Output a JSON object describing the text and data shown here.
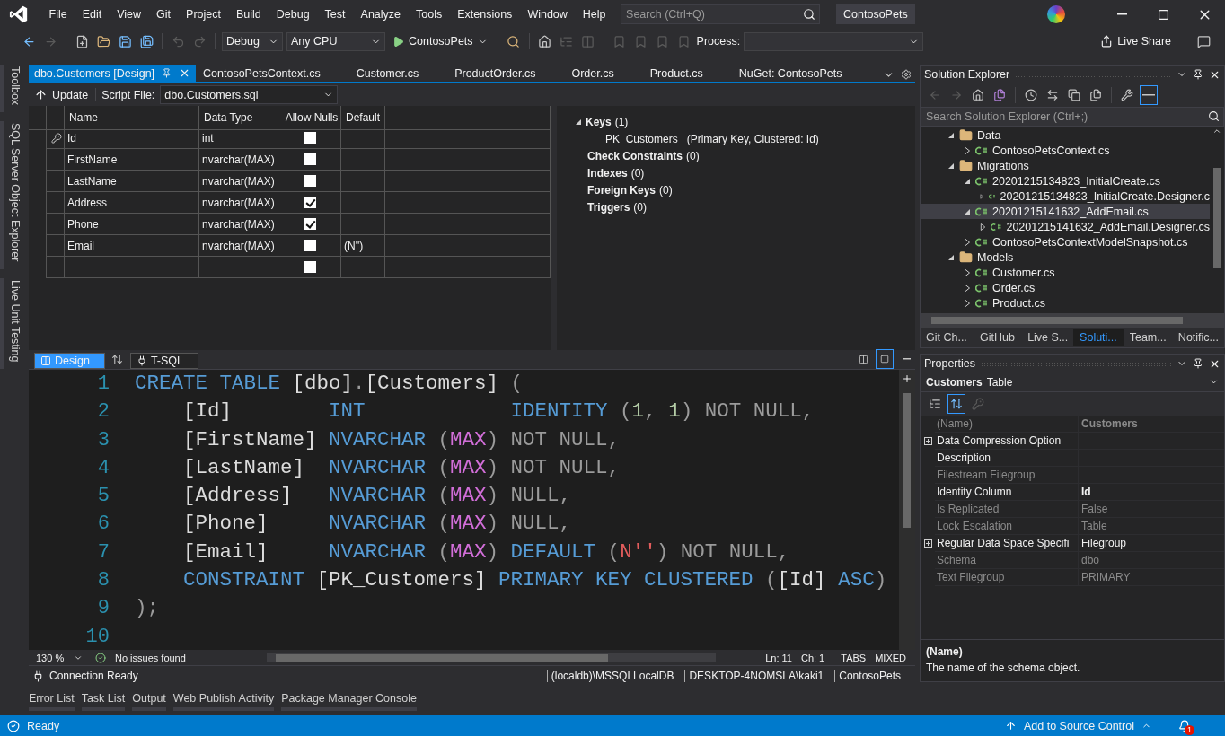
{
  "menu": {
    "items": [
      "File",
      "Edit",
      "View",
      "Git",
      "Project",
      "Build",
      "Debug",
      "Test",
      "Analyze",
      "Tools",
      "Extensions",
      "Window",
      "Help"
    ],
    "search": {
      "placeholder": "Search (Ctrl+Q)"
    },
    "solution_name": "ContosoPets"
  },
  "toolbar": {
    "configuration": "Debug",
    "platform": "Any CPU",
    "start_target": "ContosoPets",
    "process_label": "Process:",
    "live_share": "Live Share"
  },
  "side_tabs": [
    "Toolbox",
    "SQL Server Object Explorer",
    "Live Unit Testing"
  ],
  "document_tabs": [
    {
      "label": "dbo.Customers [Design]",
      "selected": true
    },
    {
      "label": "ContosoPetsContext.cs",
      "selected": false
    },
    {
      "label": "Customer.cs",
      "selected": false
    },
    {
      "label": "ProductOrder.cs",
      "selected": false
    },
    {
      "label": "Order.cs",
      "selected": false
    },
    {
      "label": "Product.cs",
      "selected": false
    },
    {
      "label": "NuGet: ContosoPets",
      "selected": false
    }
  ],
  "designer": {
    "update": "Update",
    "script_file_label": "Script File:",
    "script_file": "dbo.Customers.sql",
    "column_headers": [
      "Name",
      "Data Type",
      "Allow Nulls",
      "Default"
    ],
    "rows": [
      {
        "name": "Id",
        "data_type": "int",
        "allow_nulls": false,
        "primary_key": true
      },
      {
        "name": "FirstName",
        "data_type": "nvarchar(MAX)",
        "allow_nulls": false,
        "primary_key": false
      },
      {
        "name": "LastName",
        "data_type": "nvarchar(MAX)",
        "allow_nulls": false,
        "primary_key": false
      },
      {
        "name": "Address",
        "data_type": "nvarchar(MAX)",
        "allow_nulls": true,
        "primary_key": false
      },
      {
        "name": "Phone",
        "data_type": "nvarchar(MAX)",
        "allow_nulls": true,
        "primary_key": false
      },
      {
        "name": "Email",
        "data_type": "nvarchar(MAX)",
        "allow_nulls": false,
        "primary_key": false,
        "default": "(N'')"
      },
      {
        "allow_nulls": false,
        "primary_key": false
      }
    ],
    "sections": [
      {
        "title": "Keys",
        "count": "(1)",
        "expanded": true,
        "children": [
          {
            "name": "PK_Customers",
            "detail": "(Primary Key, Clustered: Id)"
          }
        ]
      },
      {
        "title": "Check Constraints",
        "count": "(0)"
      },
      {
        "title": "Indexes",
        "count": "(0)"
      },
      {
        "title": "Foreign Keys",
        "count": "(0)"
      },
      {
        "title": "Triggers",
        "count": "(0)"
      }
    ]
  },
  "view_tabs": [
    {
      "label": "Design",
      "selected": true
    },
    {
      "label": "T-SQL",
      "selected": false
    }
  ],
  "editor": {
    "lines": [
      {
        "number": "1",
        "tokens": [
          {
            "kind": "keyword",
            "text": "CREATE TABLE"
          },
          {
            "kind": "ident",
            "text": " [dbo]"
          },
          {
            "kind": "punct",
            "text": "."
          },
          {
            "kind": "ident",
            "text": "[Customers] "
          },
          {
            "kind": "punct",
            "text": "("
          }
        ]
      },
      {
        "number": "2",
        "tokens": [
          {
            "kind": "ident",
            "text": "    [Id]        "
          },
          {
            "kind": "keyword",
            "text": "INT            "
          },
          {
            "kind": "keyword",
            "text": "IDENTITY"
          },
          {
            "kind": "punct",
            "text": " ("
          },
          {
            "kind": "number",
            "text": "1"
          },
          {
            "kind": "punct",
            "text": ", "
          },
          {
            "kind": "number",
            "text": "1"
          },
          {
            "kind": "punct",
            "text": ") NOT NULL,"
          }
        ]
      },
      {
        "number": "3",
        "tokens": [
          {
            "kind": "ident",
            "text": "    [FirstName] "
          },
          {
            "kind": "keyword",
            "text": "NVARCHAR"
          },
          {
            "kind": "punct",
            "text": " ("
          },
          {
            "kind": "function",
            "text": "MAX"
          },
          {
            "kind": "punct",
            "text": ") NOT NULL,"
          }
        ]
      },
      {
        "number": "4",
        "tokens": [
          {
            "kind": "ident",
            "text": "    [LastName]  "
          },
          {
            "kind": "keyword",
            "text": "NVARCHAR"
          },
          {
            "kind": "punct",
            "text": " ("
          },
          {
            "kind": "function",
            "text": "MAX"
          },
          {
            "kind": "punct",
            "text": ") NOT NULL,"
          }
        ]
      },
      {
        "number": "5",
        "tokens": [
          {
            "kind": "ident",
            "text": "    [Address]   "
          },
          {
            "kind": "keyword",
            "text": "NVARCHAR"
          },
          {
            "kind": "punct",
            "text": " ("
          },
          {
            "kind": "function",
            "text": "MAX"
          },
          {
            "kind": "punct",
            "text": ") NULL,"
          }
        ]
      },
      {
        "number": "6",
        "tokens": [
          {
            "kind": "ident",
            "text": "    [Phone]     "
          },
          {
            "kind": "keyword",
            "text": "NVARCHAR"
          },
          {
            "kind": "punct",
            "text": " ("
          },
          {
            "kind": "function",
            "text": "MAX"
          },
          {
            "kind": "punct",
            "text": ") NULL,"
          }
        ]
      },
      {
        "number": "7",
        "tokens": [
          {
            "kind": "ident",
            "text": "    [Email]     "
          },
          {
            "kind": "keyword",
            "text": "NVARCHAR"
          },
          {
            "kind": "punct",
            "text": " ("
          },
          {
            "kind": "function",
            "text": "MAX"
          },
          {
            "kind": "punct",
            "text": ") "
          },
          {
            "kind": "keyword",
            "text": "DEFAULT"
          },
          {
            "kind": "punct",
            "text": " ("
          },
          {
            "kind": "string",
            "text": "N''"
          },
          {
            "kind": "punct",
            "text": ") NOT NULL,"
          }
        ]
      },
      {
        "number": "8",
        "tokens": [
          {
            "kind": "keyword",
            "text": "    CONSTRAINT"
          },
          {
            "kind": "ident",
            "text": " [PK_Customers] "
          },
          {
            "kind": "keyword",
            "text": "PRIMARY KEY CLUSTERED"
          },
          {
            "kind": "punct",
            "text": " ("
          },
          {
            "kind": "ident",
            "text": "[Id] "
          },
          {
            "kind": "keyword",
            "text": "ASC"
          },
          {
            "kind": "punct",
            "text": ")"
          }
        ]
      },
      {
        "number": "9",
        "tokens": [
          {
            "kind": "punct",
            "text": ");"
          }
        ]
      },
      {
        "number": "10"
      }
    ]
  },
  "editor_status": {
    "zoom": "130 %",
    "issues": "No issues found",
    "line": "Ln: 11",
    "column": "Ch: 1",
    "indent": "TABS",
    "line_endings": "MIXED"
  },
  "connection": {
    "state": "Connection Ready",
    "server": "(localdb)\\MSSQLLocalDB",
    "user": "DESKTOP-4NOMSLA\\kaki1",
    "database": "ContosoPets"
  },
  "bottom_tabs": [
    "Error List",
    "Task List",
    "Output",
    "Web Publish Activity",
    "Package Manager Console"
  ],
  "solution_explorer": {
    "title": "Solution Explorer",
    "search": {
      "placeholder": "Search Solution Explorer (Ctrl+;)"
    },
    "tree": [
      {
        "label": "Data",
        "kind": "folder",
        "expanded": true,
        "selected": false,
        "children": [
          {
            "label": "ContosoPetsContext.cs",
            "kind": "csharp",
            "expanded": false,
            "selected": false
          }
        ]
      },
      {
        "label": "Migrations",
        "kind": "folder",
        "expanded": true,
        "selected": false,
        "children": [
          {
            "label": "20201215134823_InitialCreate.cs",
            "kind": "csharp",
            "expanded": true,
            "selected": false,
            "children": [
              {
                "label": "20201215134823_InitialCreate.Designer.c",
                "kind": "csharp",
                "expanded": false,
                "selected": false
              }
            ]
          },
          {
            "label": "20201215141632_AddEmail.cs",
            "kind": "csharp",
            "expanded": true,
            "selected": true,
            "children": [
              {
                "label": "20201215141632_AddEmail.Designer.cs",
                "kind": "csharp",
                "expanded": false,
                "selected": false
              }
            ]
          },
          {
            "label": "ContosoPetsContextModelSnapshot.cs",
            "kind": "csharp",
            "expanded": false,
            "selected": false
          }
        ]
      },
      {
        "label": "Models",
        "kind": "folder",
        "expanded": true,
        "selected": false,
        "children": [
          {
            "label": "Customer.cs",
            "kind": "csharp",
            "expanded": false,
            "selected": false
          },
          {
            "label": "Order.cs",
            "kind": "csharp",
            "expanded": false,
            "selected": false
          },
          {
            "label": "Product.cs",
            "kind": "csharp",
            "expanded": false,
            "selected": false
          }
        ]
      }
    ],
    "tabs": [
      {
        "label": "Git Ch...",
        "selected": false
      },
      {
        "label": "GitHub",
        "selected": false
      },
      {
        "label": "Live S...",
        "selected": false
      },
      {
        "label": "Soluti...",
        "selected": true
      },
      {
        "label": "Team...",
        "selected": false
      },
      {
        "label": "Notific...",
        "selected": false
      }
    ]
  },
  "properties": {
    "title": "Properties",
    "object_name": "Customers",
    "object_type": "Table",
    "rows": [
      {
        "name": "(Name)",
        "value": "Customers",
        "expandable": false,
        "readonly": true,
        "modified": true
      },
      {
        "name": "Data Compression Option",
        "expandable": true,
        "readonly": false
      },
      {
        "name": "Description",
        "expandable": false,
        "readonly": false
      },
      {
        "name": "Filestream Filegroup",
        "expandable": false,
        "readonly": true
      },
      {
        "name": "Identity Column",
        "value": "Id",
        "expandable": false,
        "readonly": false,
        "modified": true
      },
      {
        "name": "Is Replicated",
        "value": "False",
        "expandable": false,
        "readonly": true,
        "modified": false
      },
      {
        "name": "Lock Escalation",
        "value": "Table",
        "expandable": false,
        "readonly": true,
        "modified": false
      },
      {
        "name": "Regular Data Space Specifi",
        "value": "Filegroup",
        "expandable": true,
        "readonly": false,
        "modified": false
      },
      {
        "name": "Schema",
        "value": "dbo",
        "expandable": false,
        "readonly": true,
        "modified": false
      },
      {
        "name": "Text Filegroup",
        "value": "PRIMARY",
        "expandable": false,
        "readonly": true,
        "modified": false
      }
    ],
    "description_title": "(Name)",
    "description": "The name of the schema object."
  },
  "status_bar": {
    "text": "Ready",
    "source_control": "Add to Source Control",
    "notifications": "1"
  }
}
